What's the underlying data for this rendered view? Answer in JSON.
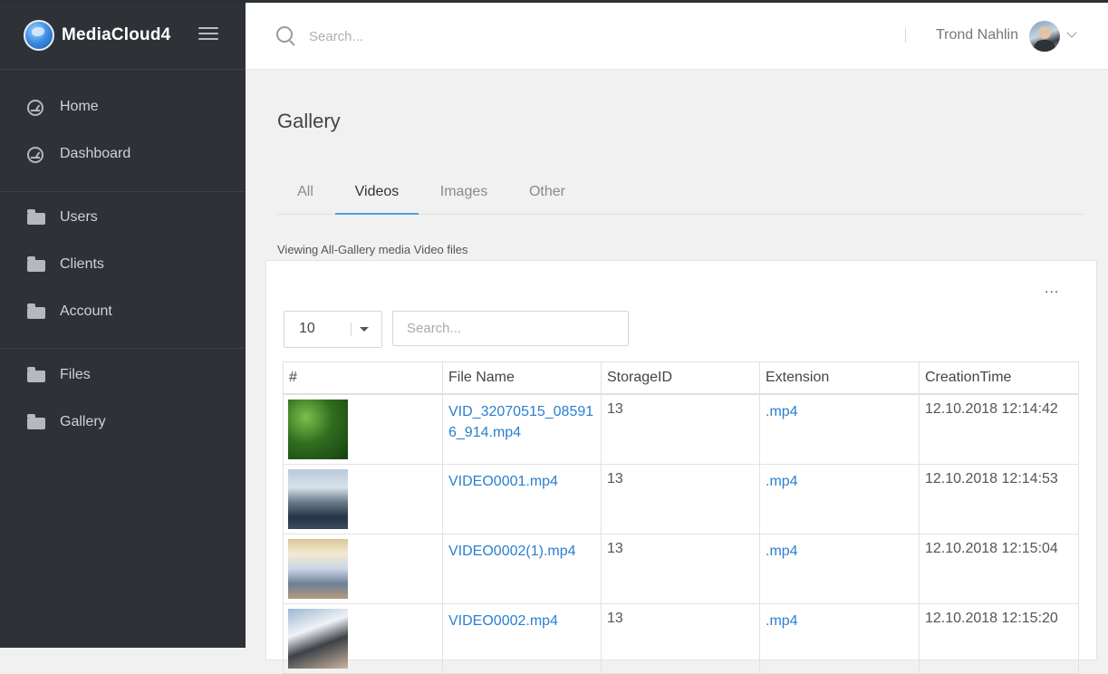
{
  "app": {
    "name": "MediaCloud4"
  },
  "sidebar": {
    "groups": [
      [
        {
          "label": "Home",
          "icon": "gauge-icon"
        },
        {
          "label": "Dashboard",
          "icon": "gauge-icon"
        }
      ],
      [
        {
          "label": "Users",
          "icon": "folder-icon"
        },
        {
          "label": "Clients",
          "icon": "folder-icon"
        },
        {
          "label": "Account",
          "icon": "folder-icon"
        }
      ],
      [
        {
          "label": "Files",
          "icon": "folder-icon"
        },
        {
          "label": "Gallery",
          "icon": "folder-icon"
        }
      ]
    ]
  },
  "header": {
    "search_placeholder": "Search...",
    "user_name": "Trond Nahlin"
  },
  "page": {
    "title": "Gallery",
    "tabs": [
      {
        "label": "All",
        "active": false
      },
      {
        "label": "Videos",
        "active": true
      },
      {
        "label": "Images",
        "active": false
      },
      {
        "label": "Other",
        "active": false
      }
    ],
    "subtitle": "Viewing All-Gallery media Video files"
  },
  "table_controls": {
    "more": "...",
    "page_length": "10",
    "search_placeholder": "Search..."
  },
  "table": {
    "columns": [
      "#",
      "File Name",
      "StorageID",
      "Extension",
      "CreationTime"
    ],
    "rows": [
      {
        "file_name": "VID_32070515_085916_914.mp4",
        "storage_id": "13",
        "extension": ".mp4",
        "creation_time": "12.10.2018 12:14:42"
      },
      {
        "file_name": "VIDEO0001.mp4",
        "storage_id": "13",
        "extension": ".mp4",
        "creation_time": "12.10.2018 12:14:53"
      },
      {
        "file_name": "VIDEO0002(1).mp4",
        "storage_id": "13",
        "extension": ".mp4",
        "creation_time": "12.10.2018 12:15:04"
      },
      {
        "file_name": "VIDEO0002.mp4",
        "storage_id": "13",
        "extension": ".mp4",
        "creation_time": "12.10.2018 12:15:20"
      }
    ]
  },
  "colors": {
    "sidebar_bg": "#2e3136",
    "accent": "#4aa3df",
    "link": "#2a7fd0"
  }
}
